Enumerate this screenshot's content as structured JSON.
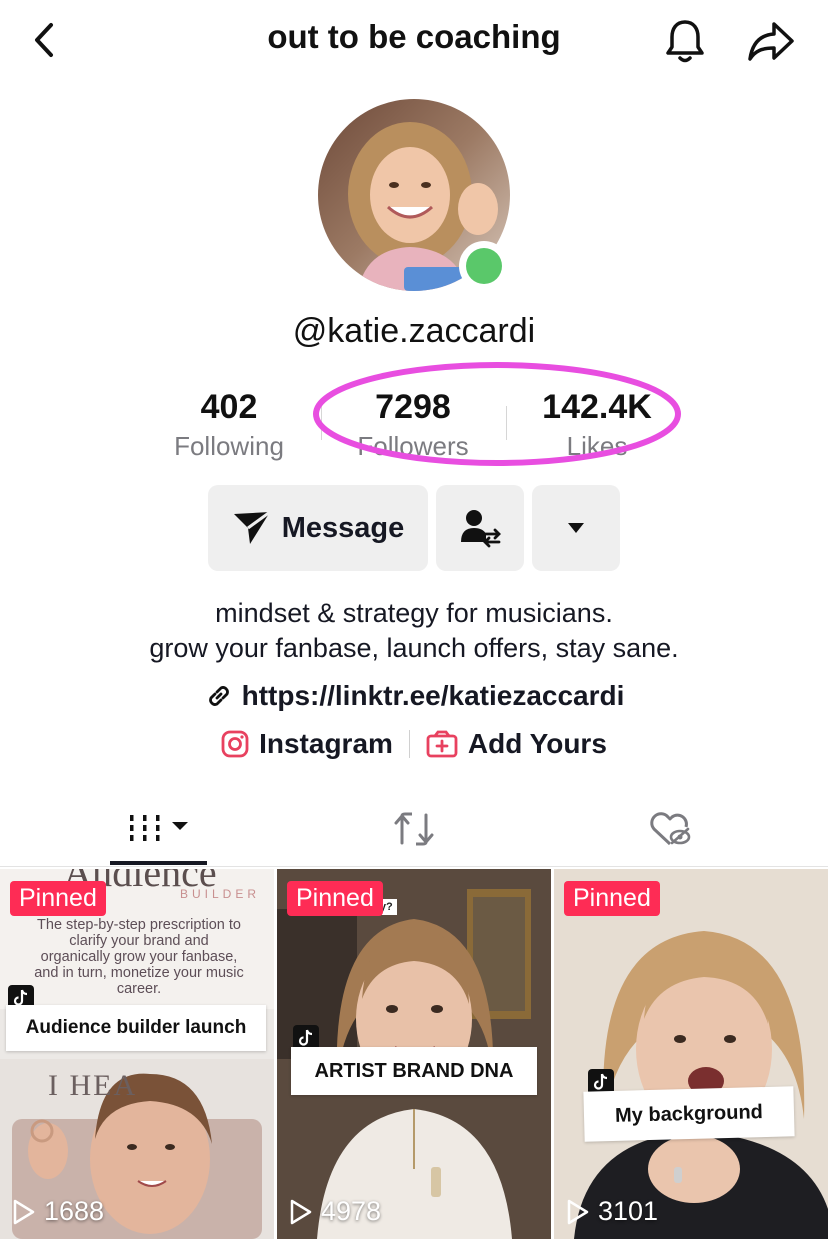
{
  "header": {
    "title": "out to be coaching"
  },
  "profile": {
    "username": "@katie.zaccardi"
  },
  "stats": [
    {
      "value": "402",
      "label": "Following"
    },
    {
      "value": "7298",
      "label": "Followers"
    },
    {
      "value": "142.4K",
      "label": "Likes"
    }
  ],
  "actions": {
    "message_label": "Message"
  },
  "bio": {
    "line1": "mindset & strategy for musicians.",
    "line2": "grow your fanbase, launch offers, stay sane.",
    "link": "https://linktr.ee/katiezaccardi",
    "instagram": "Instagram",
    "add_yours": "Add Yours"
  },
  "colors": {
    "accent": "#fe2c55",
    "highlight": "#e84ee0",
    "online": "#5ac86a"
  },
  "videos": [
    {
      "pinned": "Pinned",
      "views": "1688",
      "overlay_title": "Audience",
      "overlay_sub": "BUILDER",
      "overlay_text": "The step-by-step prescription to clarify your brand and organically grow your fanbase, and in turn, monetize your music career.",
      "caption": "Audience builder launch",
      "bg_text": "I HEA"
    },
    {
      "pinned": "Pinned",
      "views": "4978",
      "caption": "ARTIST BRAND DNA",
      "bg_text": "ney?"
    },
    {
      "pinned": "Pinned",
      "views": "3101",
      "caption": "My background"
    }
  ]
}
